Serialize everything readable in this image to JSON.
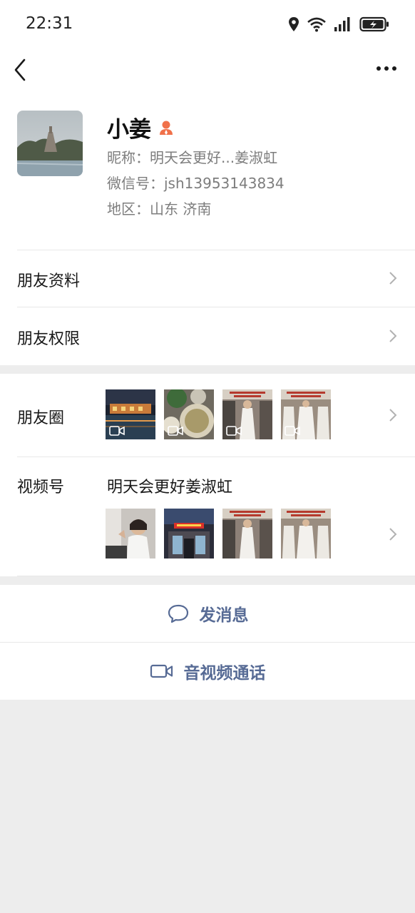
{
  "status_bar": {
    "time": "22:31"
  },
  "profile": {
    "name": "小姜",
    "nickname": "昵称：明天会更好...姜淑虹",
    "wechat_id": "微信号：jsh13953143834",
    "region": "地区：山东  济南"
  },
  "rows": {
    "friend_info": "朋友资料",
    "friend_permissions": "朋友权限",
    "moments": "朋友圈",
    "channels": "视频号",
    "channels_name": "明天会更好姜淑虹"
  },
  "actions": {
    "send_message": "发消息",
    "av_call": "音视频通话"
  },
  "colors": {
    "link_blue": "#576b95",
    "gender_badge": "#f0714a",
    "background": "#ededed"
  }
}
